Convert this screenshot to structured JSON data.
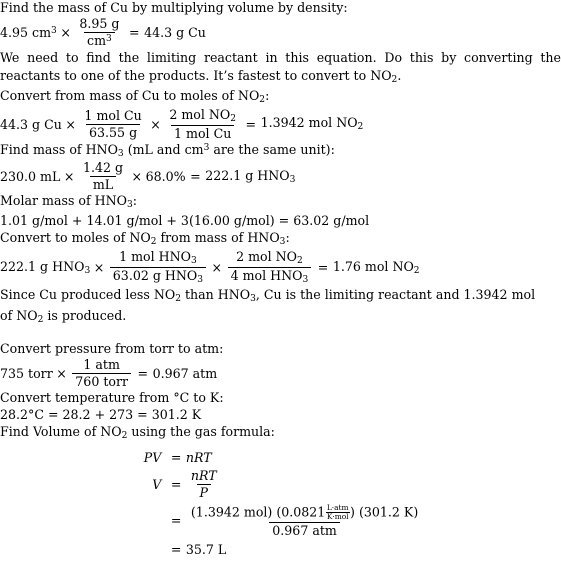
{
  "document": {
    "type": "chemistry-worked-solution",
    "background_color": "#ffffff",
    "text_color": "#000000"
  },
  "steps": {
    "s1_heading": "Find the mass of Cu by multiplying volume by density:",
    "s1_eq": {
      "lhs_value": "4.95 cm",
      "lhs_exp": "3",
      "times": "×",
      "frac_num": "8.95 g",
      "frac_den": "cm",
      "frac_den_exp": "3",
      "equals": "=",
      "result": "44.3 g Cu"
    },
    "s2_para": "We need to find the limiting reactant in this equation. Do this by converting the reactants to one of the products. It’s fastest to convert to NO",
    "s2_para_sub": "2",
    "s2_para_end": ".",
    "s3_heading_a": "Convert from mass of Cu to moles of NO",
    "s3_heading_sub": "2",
    "s3_heading_b": ":",
    "s3_eq": {
      "start": "44.3 g Cu",
      "times1": "×",
      "f1_num": "1 mol Cu",
      "f1_den": "63.55 g",
      "times2": "×",
      "f2_num": "2 mol NO",
      "f2_num_sub": "2",
      "f2_den": "1 mol Cu",
      "equals": "=",
      "result": "1.3942 mol NO",
      "result_sub": "2"
    },
    "s4_heading_a": "Find mass of HNO",
    "s4_heading_sub": "3",
    "s4_heading_b": " (mL and cm",
    "s4_heading_sup": "3",
    "s4_heading_c": " are the same unit):",
    "s4_eq": {
      "start": "230.0 mL",
      "times1": "×",
      "f1_num": "1.42 g",
      "f1_den": "mL",
      "times2": "×",
      "percent": "68.0%",
      "equals": "=",
      "result": "222.1 g HNO",
      "result_sub": "3"
    },
    "s5_heading_a": "Molar mass of HNO",
    "s5_heading_sub": "3",
    "s5_heading_b": ":",
    "s5_eq": "1.01 g/mol + 14.01 g/mol + 3(16.00 g/mol) = 63.02 g/mol",
    "s6_heading_a": "Convert to moles of NO",
    "s6_heading_sub1": "2",
    "s6_heading_b": " from mass of HNO",
    "s6_heading_sub2": "3",
    "s6_heading_c": ":",
    "s6_eq": {
      "start": "222.1 g HNO",
      "start_sub": "3",
      "times1": "×",
      "f1_num": "1 mol HNO",
      "f1_num_sub": "3",
      "f1_den": "63.02 g HNO",
      "f1_den_sub": "3",
      "times2": "×",
      "f2_num": "2 mol NO",
      "f2_num_sub": "2",
      "f2_den": "4 mol HNO",
      "f2_den_sub": "3",
      "equals": "=",
      "result": "1.76 mol NO",
      "result_sub": "2"
    },
    "s7_conclusion_a": "Since Cu produced less NO",
    "s7_conclusion_sub1": "2",
    "s7_conclusion_b": " than HNO",
    "s7_conclusion_sub2": "3",
    "s7_conclusion_c": ", Cu is the limiting reactant and 1.3942 mol",
    "s7_conclusion_d": "of NO",
    "s7_conclusion_sub3": "2",
    "s7_conclusion_e": " is produced.",
    "s8_heading": "Convert pressure from torr to atm:",
    "s8_eq": {
      "start": "735 torr",
      "times": "×",
      "f_num": "1 atm",
      "f_den": "760 torr",
      "equals": "=",
      "result": "0.967 atm"
    },
    "s9_heading": "Convert temperature from °C to K:",
    "s9_eq": "28.2°C = 28.2 + 273 = 301.2 K",
    "s10_heading_a": "Find Volume of NO",
    "s10_heading_sub": "2",
    "s10_heading_b": " using the gas formula:"
  },
  "final_equation": {
    "row1_lhs": "PV",
    "row1_rel": "=",
    "row1_rhs": "nRT",
    "row2_lhs": "V",
    "row2_rel": "=",
    "row2_num": "nRT",
    "row2_den": "P",
    "row3_rel": "=",
    "row3_num_part1": "(1.3942 mol) (0.0821",
    "row3_units_num": "L·atm",
    "row3_units_den": "K·mol",
    "row3_num_part2": ") (301.2 K)",
    "row3_den": "0.967 atm",
    "row4_rel": "=",
    "row4_value": "35.7 L"
  }
}
